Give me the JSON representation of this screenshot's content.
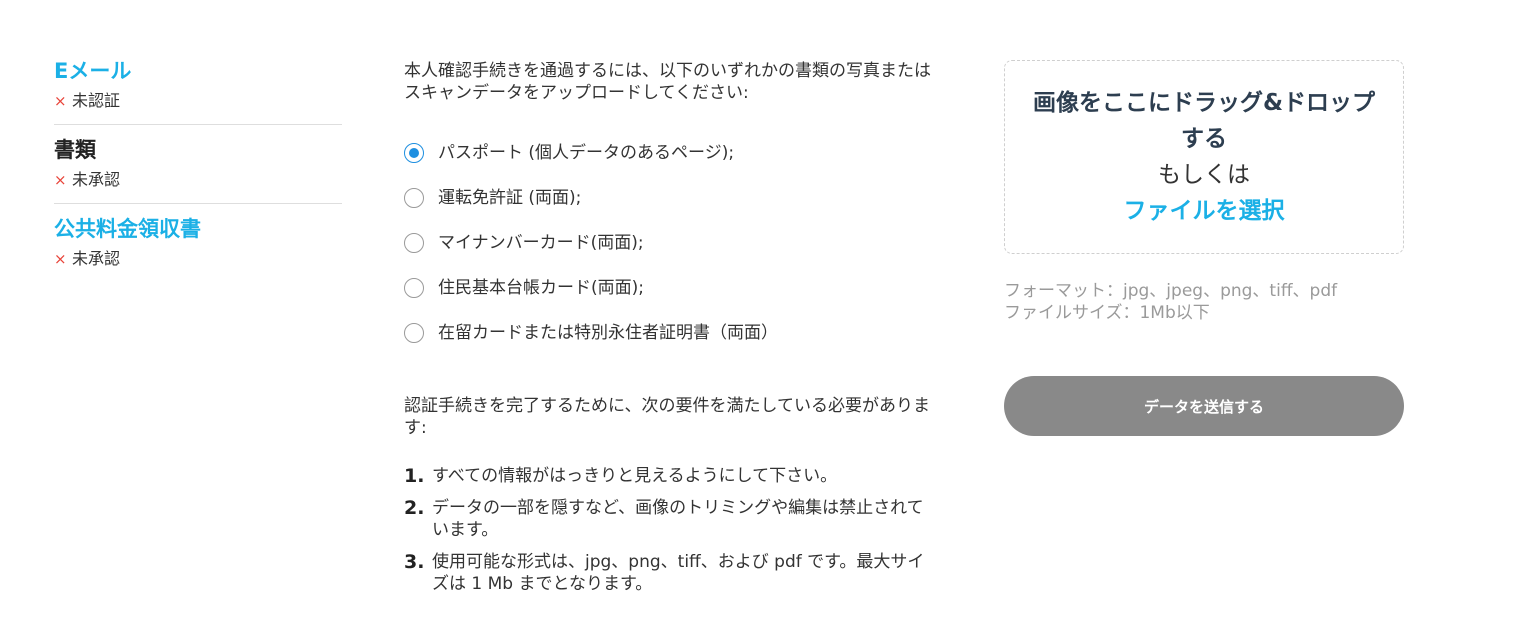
{
  "status": {
    "items": [
      {
        "title": "Eメール",
        "state": "未認証",
        "linked": true
      },
      {
        "title": "書類",
        "state": "未承認",
        "linked": false
      },
      {
        "title": "公共料金領収書",
        "state": "未承認",
        "linked": true
      }
    ],
    "x_icon": "×",
    "colors": {
      "link": "#1bb0e6",
      "error": "#e8443a"
    }
  },
  "instructions": {
    "intro": "本人確認手続きを通過するには、以下のいずれかの書類の写真またはスキャンデータをアップロードしてください:",
    "options": [
      {
        "label": "パスポート (個人データのあるページ);",
        "selected": true
      },
      {
        "label": "運転免許証 (両面);",
        "selected": false
      },
      {
        "label": "マイナンバーカード(両面);",
        "selected": false
      },
      {
        "label": "住民基本台帳カード(両面);",
        "selected": false
      },
      {
        "label": "在留カードまたは特別永住者証明書（両面）",
        "selected": false
      }
    ],
    "requirements_intro": "認証手続きを完了するために、次の要件を満たしている必要があります:",
    "requirements": [
      {
        "num": "1.",
        "text": "すべての情報がはっきりと見えるようにして下さい。"
      },
      {
        "num": "2.",
        "text": "データの一部を隠すなど、画像のトリミングや編集は禁止されています。"
      },
      {
        "num": "3.",
        "text": "使用可能な形式は、jpg、png、tiff、および pdf です。最大サイズは 1 Mb までとなります。"
      }
    ]
  },
  "upload": {
    "dropzone_title": "画像をここにドラッグ&ドロップする",
    "or_text": "もしくは",
    "choose_file": "ファイルを選択",
    "format_line": "フォーマット：jpg、jpeg、png、tiff、pdf",
    "size_line": "ファイルサイズ：1Mb以下",
    "submit_label": "データを送信する"
  }
}
